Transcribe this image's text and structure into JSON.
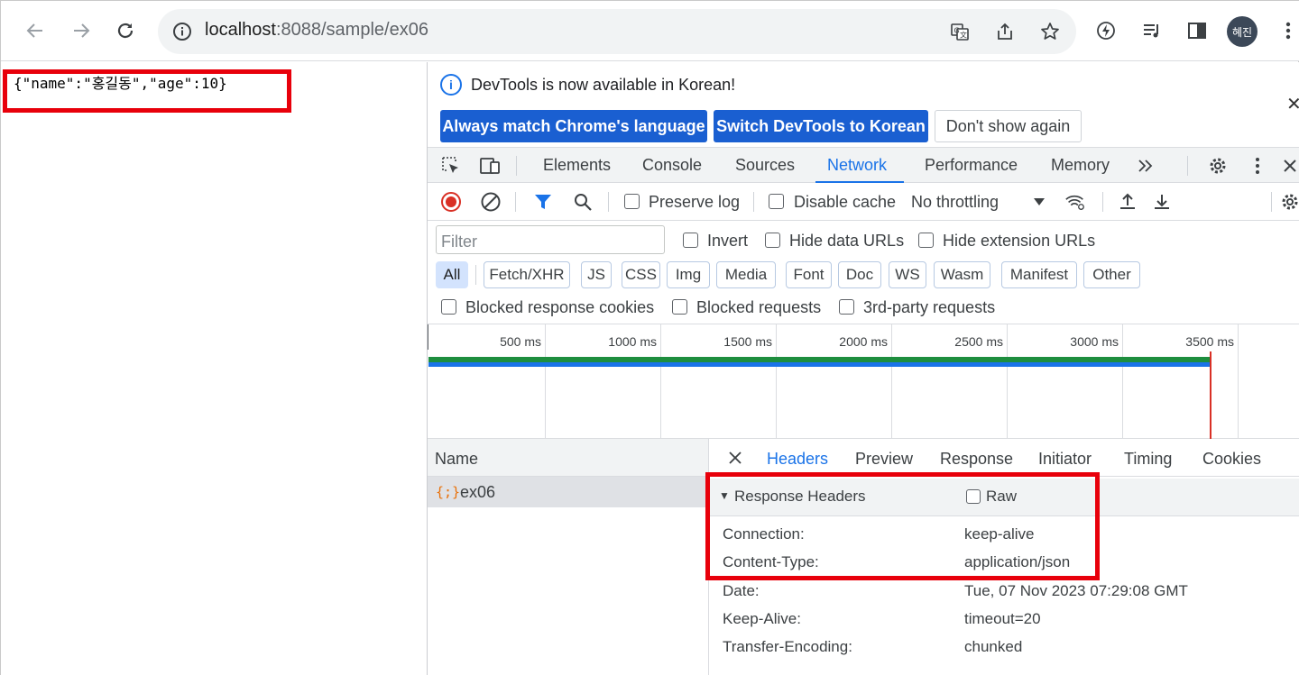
{
  "browser": {
    "url_host": "localhost",
    "url_path": ":8088/sample/ex06",
    "profile_initials": "혜진"
  },
  "page": {
    "json_text": "{\"name\":\"홍길동\",\"age\":10}"
  },
  "devtools": {
    "infobar": {
      "message": "DevTools is now available in Korean!",
      "btn_match": "Always match Chrome's language",
      "btn_switch": "Switch DevTools to Korean",
      "btn_dismiss": "Don't show again"
    },
    "tabs": [
      "Elements",
      "Console",
      "Sources",
      "Network",
      "Performance",
      "Memory"
    ],
    "active_tab": "Network",
    "network_toolbar": {
      "preserve_log": "Preserve log",
      "disable_cache": "Disable cache",
      "throttling": "No throttling"
    },
    "filter": {
      "placeholder": "Filter",
      "invert": "Invert",
      "hide_data_urls": "Hide data URLs",
      "hide_extension_urls": "Hide extension URLs",
      "types": [
        "All",
        "Fetch/XHR",
        "JS",
        "CSS",
        "Img",
        "Media",
        "Font",
        "Doc",
        "WS",
        "Wasm",
        "Manifest",
        "Other"
      ],
      "active_type": "All",
      "blocked_cookies": "Blocked response cookies",
      "blocked_requests": "Blocked requests",
      "third_party": "3rd-party requests"
    },
    "timeline_ticks": [
      "500 ms",
      "1000 ms",
      "1500 ms",
      "2000 ms",
      "2500 ms",
      "3000 ms",
      "3500 ms"
    ],
    "requests": {
      "header": "Name",
      "items": [
        {
          "name": "ex06",
          "icon": "{;}"
        }
      ]
    },
    "detail": {
      "tabs": [
        "Headers",
        "Preview",
        "Response",
        "Initiator",
        "Timing",
        "Cookies"
      ],
      "active_tab": "Headers",
      "section_title": "Response Headers",
      "raw_label": "Raw",
      "headers": [
        {
          "name": "Connection:",
          "value": "keep-alive"
        },
        {
          "name": "Content-Type:",
          "value": "application/json"
        },
        {
          "name": "Date:",
          "value": "Tue, 07 Nov 2023 07:29:08 GMT"
        },
        {
          "name": "Keep-Alive:",
          "value": "timeout=20"
        },
        {
          "name": "Transfer-Encoding:",
          "value": "chunked"
        }
      ]
    }
  },
  "colors": {
    "accent": "#1a73e8",
    "highlight_box": "#e8000b",
    "timeline_green": "#1e8e3e",
    "timeline_red": "#d93025"
  }
}
